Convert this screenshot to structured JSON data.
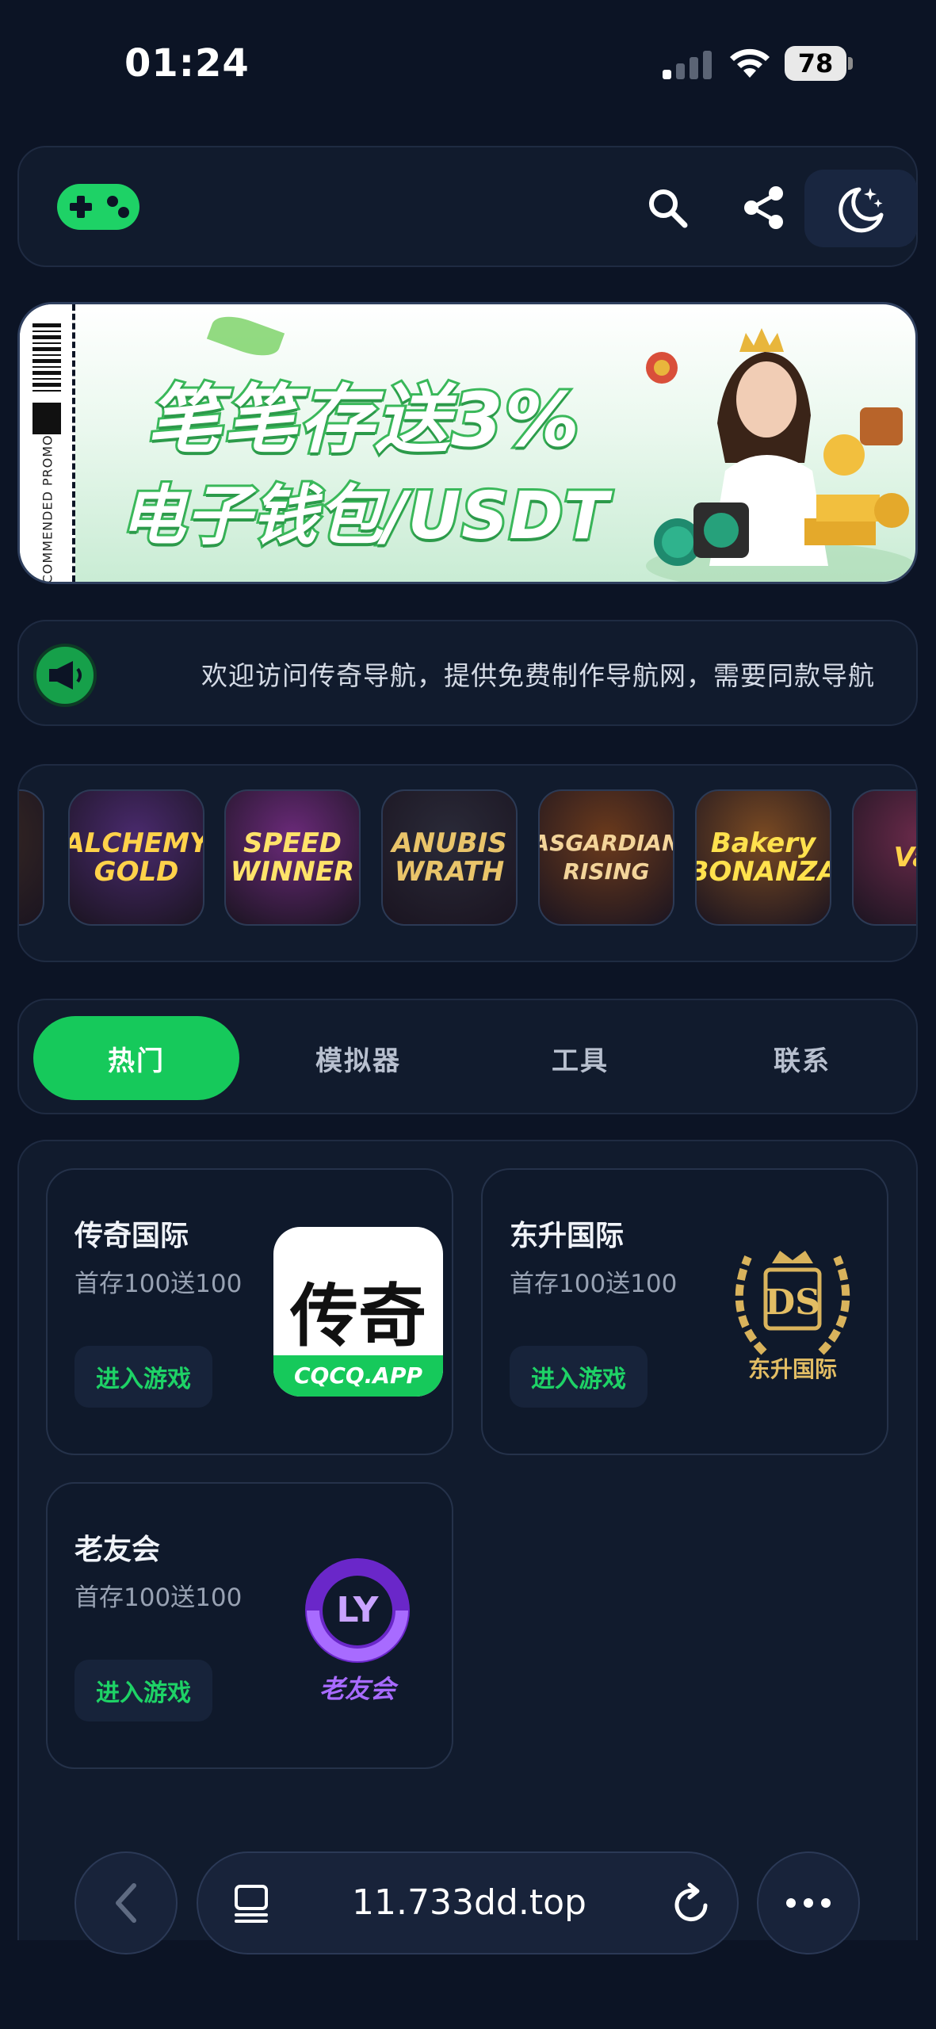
{
  "status_bar": {
    "time": "01:24",
    "battery": "78"
  },
  "header": {
    "logo_icon": "gamepad-icon",
    "search_icon": "search-icon",
    "share_icon": "share-icon",
    "theme_icon": "moon-stars-icon"
  },
  "banner": {
    "side_label": "RECOMMENDED PROMO",
    "line1": "笔笔存送3%",
    "line2": "电子钱包/USDT"
  },
  "notice": {
    "icon": "megaphone-icon",
    "text": "欢迎访问传奇导航，提供免费制作导航网，需要同款导航"
  },
  "games": [
    {
      "title": "",
      "color": "#3a2a24"
    },
    {
      "title": "ALCHEMY GOLD",
      "color": "#4a2a6e"
    },
    {
      "title": "SPEED WINNER",
      "color": "#6b2a7a"
    },
    {
      "title": "ANUBIS WRATH",
      "color": "#2a2a38"
    },
    {
      "title": "ASGARDIAN RISING",
      "color": "#6b3a1c"
    },
    {
      "title": "Bakery BONANZA",
      "color": "#7a4a22"
    },
    {
      "title": "Vac",
      "color": "#6a2a4a"
    }
  ],
  "tabs": [
    {
      "label": "热门",
      "active": true
    },
    {
      "label": "模拟器",
      "active": false
    },
    {
      "label": "工具",
      "active": false
    },
    {
      "label": "联系",
      "active": false
    }
  ],
  "sites": [
    {
      "name": "传奇国际",
      "desc": "首存100送100",
      "button": "进入游戏",
      "logo_main": "传奇",
      "logo_sub": "CQCQ.APP"
    },
    {
      "name": "东升国际",
      "desc": "首存100送100",
      "button": "进入游戏",
      "logo_main": "DS",
      "logo_sub": "东升国际"
    },
    {
      "name": "老友会",
      "desc": "首存100送100",
      "button": "进入游戏",
      "logo_main": "LY",
      "logo_sub": "老友会"
    }
  ],
  "browser": {
    "url": "11.733dd.top",
    "back_icon": "chevron-left-icon",
    "tabs_icon": "tabs-icon",
    "reload_icon": "reload-icon",
    "more_icon": "more-dots-icon"
  },
  "colors": {
    "accent": "#16c95b",
    "background": "#0c1425",
    "card": "#111b2d"
  }
}
